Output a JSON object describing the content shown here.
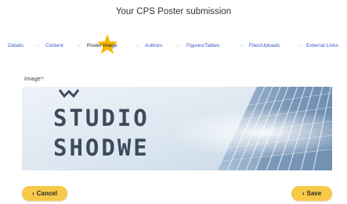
{
  "page": {
    "title": "Your CPS Poster submission"
  },
  "steps": [
    {
      "label": "Details",
      "active": false
    },
    {
      "label": "Content",
      "active": false
    },
    {
      "label": "Poster Image",
      "active": true
    },
    {
      "label": "Authors",
      "active": false
    },
    {
      "label": "Figures/Tables",
      "active": false
    },
    {
      "label": "Files/Uploads",
      "active": false
    },
    {
      "label": "External Links",
      "active": false
    }
  ],
  "step_separator": "→",
  "colors": {
    "accent": "#f7c948",
    "step_link": "#3a56c5",
    "step_active": "#222222",
    "star": "#f5b800"
  },
  "image_field": {
    "label": "Image*:",
    "logo_line1": "STUDIO",
    "logo_line2": "SHODWE"
  },
  "buttons": {
    "cancel_label": "Cancel",
    "save_label": "Save",
    "chevron_icon": "chevron-right-icon"
  }
}
